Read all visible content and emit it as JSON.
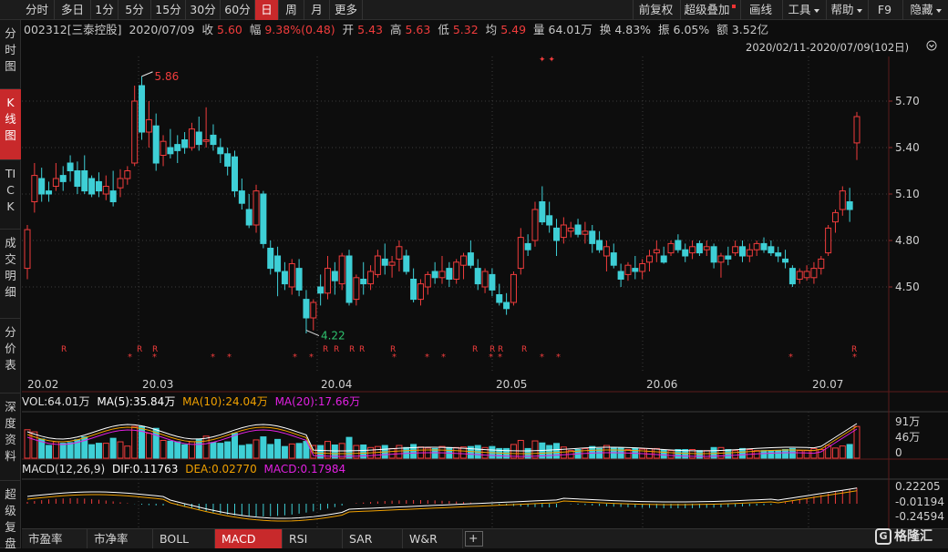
{
  "toolbar": {
    "periods": [
      "分时",
      "多日",
      "1分",
      "5分",
      "15分",
      "30分",
      "60分",
      "日",
      "周",
      "月",
      "更多"
    ],
    "active_period": "日",
    "restore": "前复权",
    "overlay": "超级叠加",
    "draw": "画线",
    "tools": "工具",
    "help": "帮助",
    "f9": "F9",
    "hide": "隐藏"
  },
  "sidebar": {
    "items": [
      {
        "label": "分时图"
      },
      {
        "label": "K线图"
      },
      {
        "label": "TICK"
      },
      {
        "label": "成交明细"
      },
      {
        "label": "分价表"
      },
      {
        "label": "深度资料"
      },
      {
        "label": "超级复盘"
      }
    ]
  },
  "quote": {
    "code_name": "002312[三泰控股]",
    "date": "2020/07/09",
    "close_label": "收",
    "close": "5.60",
    "amp_label": "幅",
    "amp": "9.38%(0.48)",
    "open_label": "开",
    "open": "5.43",
    "high_label": "高",
    "high": "5.63",
    "low_label": "低",
    "low": "5.32",
    "avg_label": "均",
    "avg": "5.49",
    "vol_label": "量",
    "vol": "64.01万",
    "turn_label": "换",
    "turn": "4.83%",
    "swing_label": "振",
    "swing": "6.05%",
    "amt_label": "额",
    "amt": "3.52亿"
  },
  "range": "2020/02/11-2020/07/09(102日)",
  "colors": {
    "up": "#f03c3c",
    "down": "#3ecfd6",
    "ma5": "#ffffff",
    "ma10": "#f0a000",
    "ma20": "#e020e0",
    "dea": "#f0a000",
    "macd_line": "#f0a000"
  },
  "price_axis": {
    "ticks": [
      "5.70",
      "5.40",
      "5.10",
      "4.80",
      "4.50"
    ],
    "max_label": "5.86",
    "min_label": "4.22"
  },
  "date_axis": [
    "20.02",
    "20.03",
    "20.04",
    "20.05",
    "20.06",
    "20.07"
  ],
  "volume": {
    "label": "VOL:64.01万",
    "ma5": "MA(5):35.84万",
    "ma10": "MA(10):24.04万",
    "ma20": "MA(20):17.66万",
    "ticks": [
      "91万",
      "46万",
      "0"
    ]
  },
  "macd": {
    "label": "MACD(12,26,9)",
    "dif": "DIF:0.11763",
    "dea": "DEA:0.02770",
    "macd": "MACD:0.17984",
    "ticks": [
      "0.22205",
      "-0.01194",
      "-0.24594"
    ]
  },
  "bottom_tabs": [
    "市盈率",
    "市净率",
    "BOLL",
    "MACD",
    "RSI",
    "SAR",
    "W&R"
  ],
  "active_bottom_tab": "MACD",
  "add_tab": "+",
  "logo": "格隆汇",
  "chart_data": {
    "type": "candlestick",
    "period": "daily",
    "x_axis_ticks": [
      "20.02",
      "20.03",
      "20.04",
      "20.05",
      "20.06",
      "20.07"
    ],
    "y_axis_ticks": [
      5.7,
      5.4,
      5.1,
      4.8,
      4.5
    ],
    "annotations": [
      {
        "text": "5.86",
        "kind": "max"
      },
      {
        "text": "4.22",
        "kind": "min"
      }
    ],
    "last_candle": {
      "date": "2020/07/09",
      "open": 5.43,
      "high": 5.63,
      "low": 5.32,
      "close": 5.6,
      "volume": "64.01万"
    },
    "macd_last": {
      "dif": 0.11763,
      "dea": 0.0277,
      "macd": 0.17984
    }
  }
}
